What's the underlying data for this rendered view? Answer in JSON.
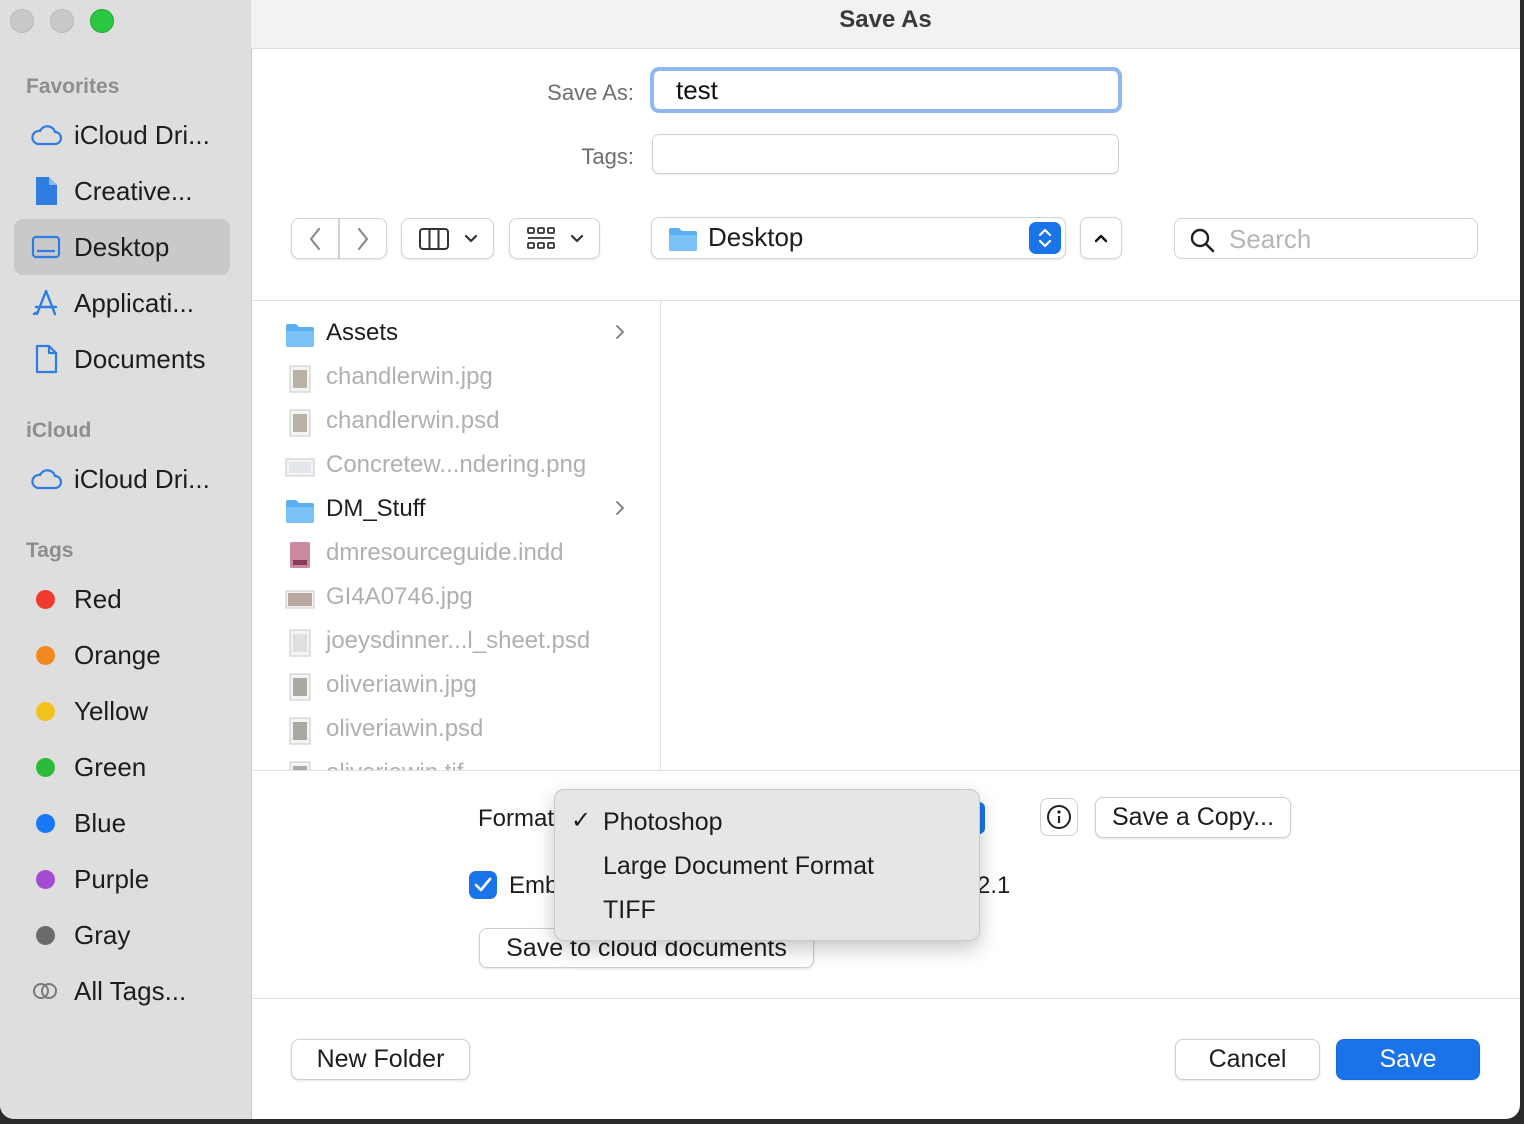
{
  "window": {
    "title": "Save As"
  },
  "sidebar": {
    "favorites_header": "Favorites",
    "favorites": [
      {
        "label": "iCloud Dri...",
        "icon": "cloud-icon"
      },
      {
        "label": "Creative...",
        "icon": "document-filled-icon"
      },
      {
        "label": "Desktop",
        "icon": "desktop-icon",
        "selected": true
      },
      {
        "label": "Applicati...",
        "icon": "applications-icon"
      },
      {
        "label": "Documents",
        "icon": "document-icon"
      }
    ],
    "icloud_header": "iCloud",
    "icloud": [
      {
        "label": "iCloud Dri...",
        "icon": "cloud-icon"
      }
    ],
    "tags_header": "Tags",
    "tags": [
      {
        "label": "Red",
        "color": "#f0392f"
      },
      {
        "label": "Orange",
        "color": "#f08a20"
      },
      {
        "label": "Yellow",
        "color": "#f0c21a"
      },
      {
        "label": "Green",
        "color": "#2bba3a"
      },
      {
        "label": "Blue",
        "color": "#1877f2"
      },
      {
        "label": "Purple",
        "color": "#a44cd1"
      },
      {
        "label": "Gray",
        "color": "#6b6b6d"
      }
    ],
    "all_tags": "All Tags..."
  },
  "form": {
    "save_as_label": "Save As:",
    "save_as_value": "test",
    "tags_label": "Tags:",
    "tags_value": ""
  },
  "toolbar": {
    "location": "Desktop",
    "search_placeholder": "Search"
  },
  "files": [
    {
      "name": "Assets",
      "type": "folder",
      "enabled": true
    },
    {
      "name": "chandlerwin.jpg",
      "type": "image",
      "enabled": false
    },
    {
      "name": "chandlerwin.psd",
      "type": "image",
      "enabled": false
    },
    {
      "name": "Concretew...ndering.png",
      "type": "image-wide",
      "enabled": false
    },
    {
      "name": "DM_Stuff",
      "type": "folder",
      "enabled": true
    },
    {
      "name": "dmresourceguide.indd",
      "type": "indd",
      "enabled": false
    },
    {
      "name": "GI4A0746.jpg",
      "type": "image-wide",
      "enabled": false
    },
    {
      "name": "joeysdinner...l_sheet.psd",
      "type": "doc",
      "enabled": false
    },
    {
      "name": "oliveriawin.jpg",
      "type": "image",
      "enabled": false
    },
    {
      "name": "oliveriawin.psd",
      "type": "image",
      "enabled": false
    },
    {
      "name": "oliveriawin.tif",
      "type": "image",
      "enabled": false
    }
  ],
  "options": {
    "format_label": "Format",
    "embed_label": "Emb",
    "embed_checked": true,
    "embed_suffix": "2.1",
    "save_copy": "Save a Copy...",
    "cloud_button": "Save to cloud documents"
  },
  "format_menu": {
    "checkmark": "✓",
    "items": [
      "Photoshop",
      "Large Document Format",
      "TIFF"
    ],
    "selected": "Photoshop"
  },
  "footer": {
    "new_folder": "New Folder",
    "cancel": "Cancel",
    "save": "Save"
  },
  "colors": {
    "accent": "#1a73e8",
    "focus_ring": "#8fb7f1"
  }
}
